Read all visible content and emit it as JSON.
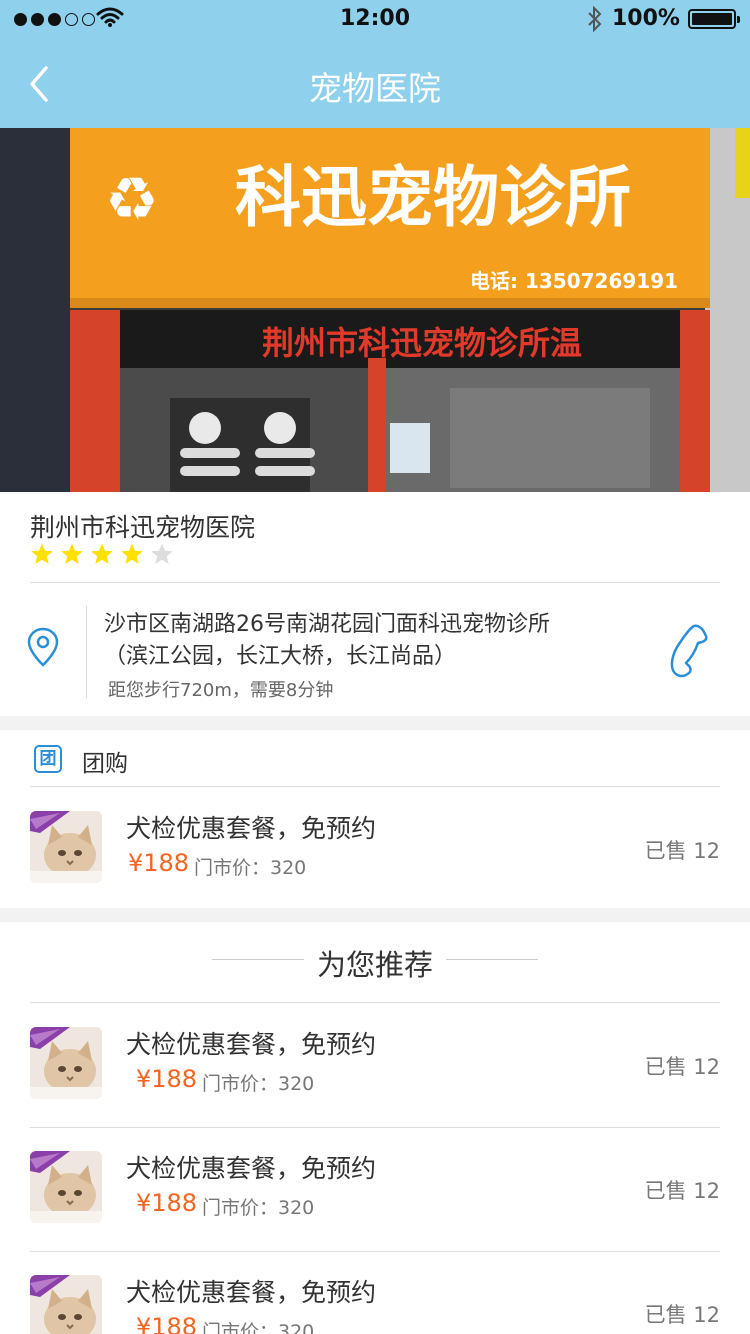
{
  "status_bar": {
    "time": "12:00",
    "battery": "100%"
  },
  "nav": {
    "title": "宠物医院"
  },
  "banner": {
    "sign_text": "科迅宠物诊所",
    "phone_text": "电话: 13507269191",
    "led_text": "荆州市科迅宠物诊所温"
  },
  "store": {
    "name": "荆州市科迅宠物医院",
    "rating": 4,
    "rating_max": 5,
    "address_line1": "沙市区南湖路26号南湖花园门面科迅宠物诊所",
    "address_line2": "（滨江公园，长江大桥，长江尚品）",
    "distance": "距您步行720m，需要8分钟"
  },
  "group_buy": {
    "icon_text": "团",
    "title": "团购",
    "items": [
      {
        "title": "犬检优惠套餐，免预约",
        "price": "¥188",
        "orig_label": "门市价：320",
        "sold": "已售 12"
      }
    ]
  },
  "recommend": {
    "title": "为您推荐",
    "items": [
      {
        "title": "犬检优惠套餐，免预约",
        "price": "¥188",
        "orig_label": "门市价：320",
        "sold": "已售 12"
      },
      {
        "title": "犬检优惠套餐，免预约",
        "price": "¥188",
        "orig_label": "门市价：320",
        "sold": "已售 12"
      },
      {
        "title": "犬检优惠套餐，免预约",
        "price": "¥188",
        "orig_label": "门市价：320",
        "sold": "已售 12"
      }
    ]
  },
  "colors": {
    "header": "#8fd0ec",
    "accent": "#2a8fd6",
    "price": "#f26522",
    "star_on": "#ffe000",
    "star_off": "#dddddd"
  },
  "icons": [
    "back-arrow-icon",
    "location-pin-icon",
    "phone-icon",
    "group-buy-icon",
    "star-icon"
  ]
}
